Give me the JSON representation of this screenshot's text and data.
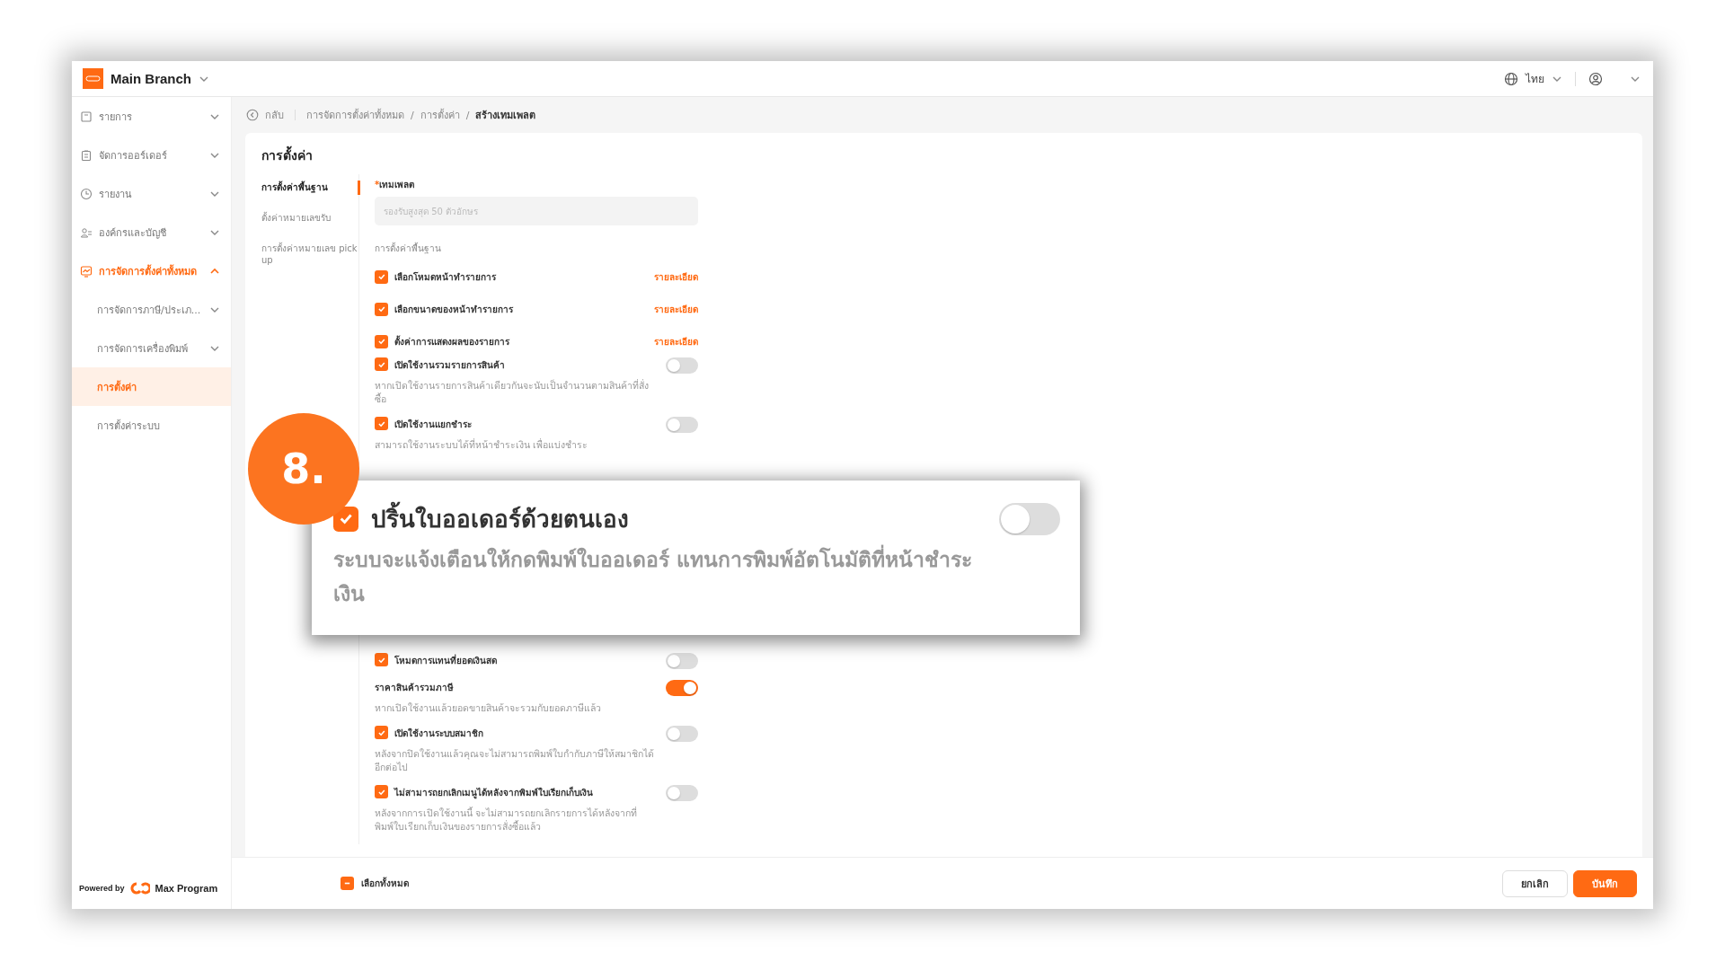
{
  "header": {
    "branch": "Main Branch",
    "language": "ไทย"
  },
  "sidebar": {
    "items": [
      {
        "label": "รายการ",
        "expanded": false,
        "selected": false
      },
      {
        "label": "จัดการออร์เดอร์",
        "expanded": false,
        "selected": false
      },
      {
        "label": "รายงาน",
        "expanded": false,
        "selected": false
      },
      {
        "label": "องค์กรและบัญชี",
        "expanded": false,
        "selected": false
      },
      {
        "label": "การจัดการตั้งค่าทั้งหมด",
        "expanded": true,
        "selected": true,
        "children": [
          {
            "label": "การจัดการภาษี/ประเภ...",
            "expanded": false,
            "selected": false
          },
          {
            "label": "การจัดการเครื่องพิมพ์",
            "expanded": false,
            "selected": false
          },
          {
            "label": "การตั้งค่า",
            "selected": true
          },
          {
            "label": "การตั้งค่าระบบ",
            "selected": false
          }
        ]
      }
    ],
    "powered_by": "Powered by",
    "brand": "Max Program"
  },
  "breadcrumb": {
    "back": "กลับ",
    "items": [
      {
        "label": "การจัดการตั้งค่าทั้งหมด",
        "separator": "/"
      },
      {
        "label": "การตั้งค่า",
        "separator": "/"
      },
      {
        "label": "สร้างเทมเพลต"
      }
    ]
  },
  "settings": {
    "title": "การตั้งค่า",
    "tabs": [
      {
        "label": "การตั้งค่าพื้นฐาน",
        "selected": true
      },
      {
        "label": "ตั้งค่าหมายเลขรับ",
        "selected": false
      },
      {
        "label": "การตั้งค่าหมายเลข pick up",
        "selected": false
      }
    ],
    "template_field": {
      "label": "เทมเพลต",
      "required_mark": "*",
      "placeholder": "รองรับสูงสุด 50 ตัวอักษร"
    },
    "section_label": "การตั้งค่าพื้นฐาน",
    "options": [
      {
        "kind": "detail",
        "label": "เลือกโหมดหน้าทำรายการ",
        "checked": true,
        "link": "รายละเอียด"
      },
      {
        "kind": "detail",
        "label": "เลือกขนาดของหน้าทำรายการ",
        "checked": true,
        "link": "รายละเอียด"
      },
      {
        "kind": "detail",
        "label": "ตั้งค่าการแสดงผลของรายการ",
        "checked": true,
        "link": "รายละเอียด"
      },
      {
        "kind": "toggle",
        "label": "เปิดใช้งานรวมรายการสินค้า",
        "checked": true,
        "on": false,
        "description": "หากเปิดใช้งานรายการสินค้าเดียวกันจะนับเป็นจำนวนตามสินค้าที่สั่งซื้อ"
      },
      {
        "kind": "toggle",
        "label": "เปิดใช้งานแยกชำระ",
        "checked": true,
        "on": false,
        "description": "สามารถใช้งานระบบได้ที่หน้าชำระเงิน เพื่อแบ่งชำระ"
      },
      {
        "kind": "hidden"
      },
      {
        "kind": "toggle",
        "label": "โหมดการแทนที่ยอดเงินสด",
        "checked": true,
        "on": false
      },
      {
        "kind": "toggle",
        "label": "ราคาสินค้ารวมภาษี",
        "on": true,
        "description": "หากเปิดใช้งานแล้วยอดขายสินค้าจะรวมกับยอดภาษีแล้ว"
      },
      {
        "kind": "toggle",
        "label": "เปิดใช้งานระบบสมาชิก",
        "checked": true,
        "on": false,
        "description": "หลังจากปิดใช้งานแล้วคุณจะไม่สามารถพิมพ์ใบกำกับภาษีให้สมาชิกได้อีกต่อไป"
      },
      {
        "kind": "toggle",
        "label": "ไม่สามารถยกเลิกเมนูได้หลังจากพิมพ์ใบเรียกเก็บเงิน",
        "checked": true,
        "on": false,
        "description": "หลังจากการเปิดใช้งานนี้ จะไม่สามารถยกเลิกรายการได้หลังจากที่พิมพ์ใบเรียกเก็บเงินของรายการสั่งซื้อแล้ว"
      }
    ]
  },
  "callout": {
    "number": "8.",
    "label": "ปริ้นใบออเดอร์ด้วยตนเอง",
    "checked": true,
    "on": false,
    "description": "ระบบจะแจ้งเตือนให้กดพิมพ์ใบออเดอร์ แทนการพิมพ์อัตโนมัติที่หน้าชำระเงิน"
  },
  "footer": {
    "select_all": "เลือกทั้งหมด",
    "indeterminate": true,
    "buttons": [
      {
        "label": "ยกเลิก",
        "kind": "secondary"
      },
      {
        "label": "บันทึก",
        "kind": "primary"
      }
    ]
  }
}
